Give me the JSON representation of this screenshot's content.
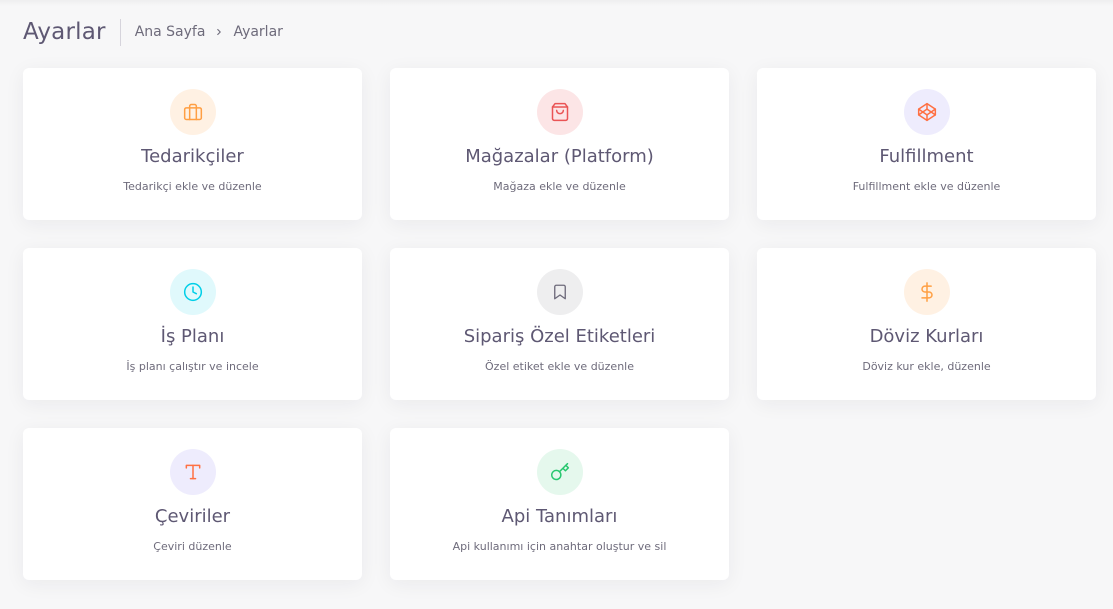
{
  "header": {
    "title": "Ayarlar",
    "breadcrumb": {
      "home": "Ana Sayfa",
      "current": "Ayarlar"
    }
  },
  "cards": [
    {
      "title": "Tedarikçiler",
      "description": "Tedarikçi ekle ve düzenle",
      "icon": "briefcase-icon",
      "color": "#ff9f43",
      "bg": "#fff1e3"
    },
    {
      "title": "Mağazalar (Platform)",
      "description": "Mağaza ekle ve düzenle",
      "icon": "shopping-bag-icon",
      "color": "#ea5455",
      "bg": "#fce5e6"
    },
    {
      "title": "Fulfillment",
      "description": "Fulfillment ekle ve düzenle",
      "icon": "codepen-icon",
      "color": "#ff7043",
      "bg": "#eeecfd"
    },
    {
      "title": "İş Planı",
      "description": "İş planı çalıştır ve incele",
      "icon": "clock-icon",
      "color": "#00cfe8",
      "bg": "#e0f9fc"
    },
    {
      "title": "Sipariş Özel Etiketleri",
      "description": "Özel etiket ekle ve düzenle",
      "icon": "bookmark-icon",
      "color": "#6e6b7b",
      "bg": "#eeeeef"
    },
    {
      "title": "Döviz Kurları",
      "description": "Döviz kur ekle, düzenle",
      "icon": "dollar-sign-icon",
      "color": "#ff9f43",
      "bg": "#fff1e3"
    },
    {
      "title": "Çeviriler",
      "description": "Çeviri düzenle",
      "icon": "type-icon",
      "color": "#ff7043",
      "bg": "#eeecfd"
    },
    {
      "title": "Api Tanımları",
      "description": "Api kullanımı için anahtar oluştur ve sil",
      "icon": "key-icon",
      "color": "#28c76f",
      "bg": "#e5f8ed"
    }
  ]
}
